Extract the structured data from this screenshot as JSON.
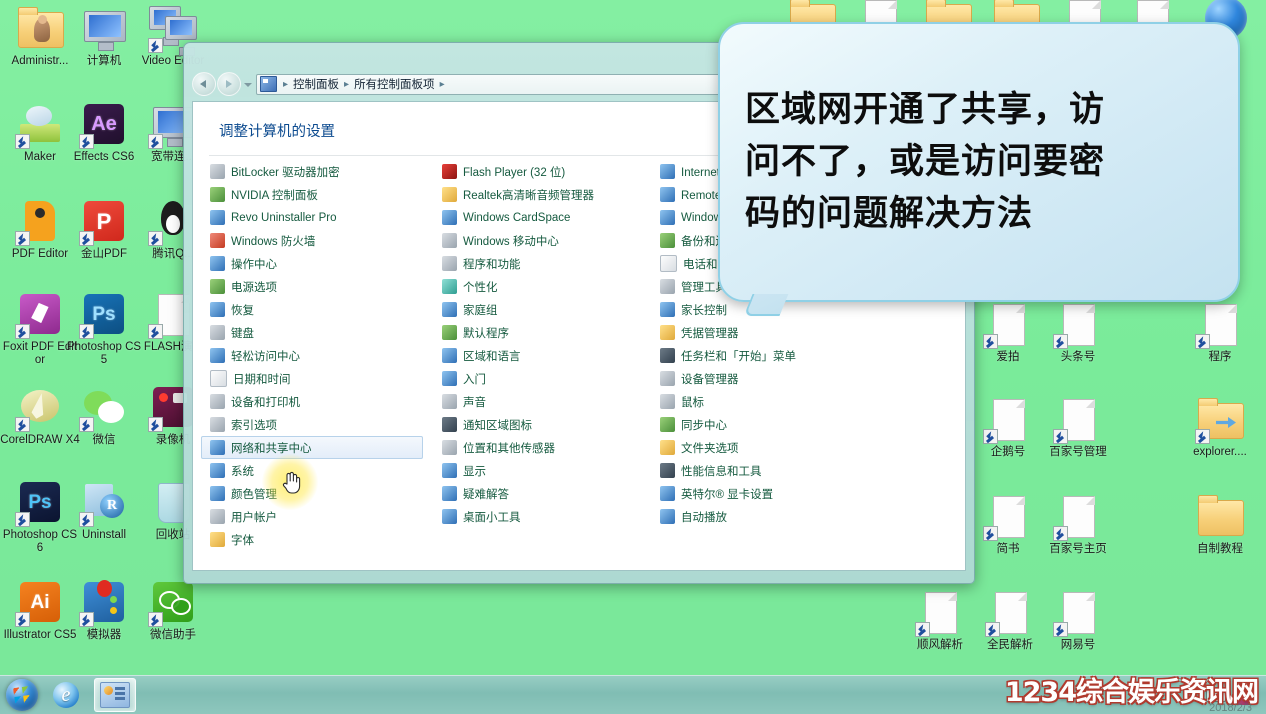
{
  "desktop": {
    "background_color": "#7ceb9c",
    "left_icons": [
      {
        "label": "Administr...",
        "art": "folder-user",
        "col": 0,
        "row": 0
      },
      {
        "label": "计算机",
        "art": "monitor",
        "col": 1,
        "row": 0
      },
      {
        "label": "Video Editor",
        "art": "monitor-dual",
        "col": 2,
        "row": 0
      },
      {
        "label": "Maker",
        "art": "cloud-box",
        "col": 0,
        "row": 1
      },
      {
        "label": "Effects CS6",
        "art": "ae",
        "col": 1,
        "row": 1
      },
      {
        "label": "宽带连...",
        "art": "monitor",
        "col": 2,
        "row": 1
      },
      {
        "label": "PDF Editor",
        "art": "pdf-orange",
        "col": 0,
        "row": 2
      },
      {
        "label": "金山PDF",
        "art": "pdf-red",
        "col": 1,
        "row": 2
      },
      {
        "label": "腾讯Q...",
        "art": "qq",
        "col": 2,
        "row": 2
      },
      {
        "label": "Foxit PDF Editor",
        "art": "foxit",
        "col": 0,
        "row": 3
      },
      {
        "label": "Photoshop CS5",
        "art": "ps-blue",
        "col": 1,
        "row": 3
      },
      {
        "label": "FLASH演...",
        "art": "doc",
        "col": 2,
        "row": 3
      },
      {
        "label": "CorelDRAW X4",
        "art": "corel",
        "col": 0,
        "row": 4
      },
      {
        "label": "微信",
        "art": "wechat",
        "col": 1,
        "row": 4
      },
      {
        "label": "录像机",
        "art": "recorder",
        "col": 2,
        "row": 4
      },
      {
        "label": "Photoshop CS6",
        "art": "ps-dark",
        "col": 0,
        "row": 5
      },
      {
        "label": "Uninstall",
        "art": "revo",
        "col": 1,
        "row": 5
      },
      {
        "label": "回收站",
        "art": "recycle",
        "col": 2,
        "row": 5
      },
      {
        "label": "Illustrator CS5",
        "art": "ai",
        "col": 0,
        "row": 6
      },
      {
        "label": "模拟器",
        "art": "emulator",
        "col": 1,
        "row": 6
      },
      {
        "label": "微信助手",
        "art": "wechat-helper",
        "col": 2,
        "row": 6
      }
    ],
    "top_right_icons": [
      {
        "label": "",
        "art": "folder"
      },
      {
        "label": "",
        "art": "doc"
      },
      {
        "label": "",
        "art": "folder"
      },
      {
        "label": "",
        "art": "folder"
      },
      {
        "label": "",
        "art": "doc"
      },
      {
        "label": "",
        "art": "doc"
      },
      {
        "label": "",
        "art": "globe"
      }
    ],
    "right_icons": [
      {
        "label": "爱拍",
        "art": "doc",
        "col": 0,
        "row": 0
      },
      {
        "label": "头条号",
        "art": "doc",
        "col": 1,
        "row": 0
      },
      {
        "label": "程序",
        "art": "doc",
        "col": 2,
        "row": 0
      },
      {
        "label": "企鹅号",
        "art": "doc",
        "col": 0,
        "row": 1
      },
      {
        "label": "百家号管理",
        "art": "doc",
        "col": 1,
        "row": 1
      },
      {
        "label": "explorer....",
        "art": "folder-explorer",
        "col": 2,
        "row": 1
      },
      {
        "label": "简书",
        "art": "doc",
        "col": 0,
        "row": 2
      },
      {
        "label": "百家号主页",
        "art": "doc",
        "col": 1,
        "row": 2
      },
      {
        "label": "自制教程",
        "art": "folder",
        "col": 2,
        "row": 2
      },
      {
        "label": "顺风解析",
        "art": "doc",
        "col": 0,
        "row": 3
      },
      {
        "label": "全民解析",
        "art": "doc",
        "col": 1,
        "row": 3
      },
      {
        "label": "网易号",
        "art": "doc",
        "col": 2,
        "row": 3
      }
    ]
  },
  "window": {
    "address": {
      "crumbs": [
        "控制面板",
        "所有控制面板项"
      ],
      "separator": "▸",
      "caret": "▾",
      "refresh_label": "↯"
    },
    "heading": "调整计算机的设置",
    "columns": [
      {
        "items": [
          {
            "label": "BitLocker 驱动器加密",
            "icon": "i-gray"
          },
          {
            "label": "NVIDIA 控制面板",
            "icon": "i-green"
          },
          {
            "label": "Revo Uninstaller Pro",
            "icon": "i-blue"
          },
          {
            "label": "Windows 防火墙",
            "icon": "i-red"
          },
          {
            "label": "操作中心",
            "icon": "i-blue"
          },
          {
            "label": "电源选项",
            "icon": "i-green"
          },
          {
            "label": "恢复",
            "icon": "i-blue"
          },
          {
            "label": "键盘",
            "icon": "i-gray"
          },
          {
            "label": "轻松访问中心",
            "icon": "i-blue"
          },
          {
            "label": "日期和时间",
            "icon": "i-white"
          },
          {
            "label": "设备和打印机",
            "icon": "i-gray"
          },
          {
            "label": "索引选项",
            "icon": "i-gray"
          },
          {
            "label": "网络和共享中心",
            "icon": "i-blue",
            "selected": true
          },
          {
            "label": "系统",
            "icon": "i-blue"
          },
          {
            "label": "颜色管理",
            "icon": "i-blue"
          },
          {
            "label": "用户帐户",
            "icon": "i-gray"
          },
          {
            "label": "字体",
            "icon": "i-yellow"
          }
        ]
      },
      {
        "items": [
          {
            "label": "Flash Player (32 位)",
            "icon": "i-flash"
          },
          {
            "label": "Realtek高清晰音频管理器",
            "icon": "i-yellow"
          },
          {
            "label": "Windows CardSpace",
            "icon": "i-blue"
          },
          {
            "label": "Windows 移动中心",
            "icon": "i-gray"
          },
          {
            "label": "程序和功能",
            "icon": "i-gray"
          },
          {
            "label": "个性化",
            "icon": "i-teal"
          },
          {
            "label": "家庭组",
            "icon": "i-blue"
          },
          {
            "label": "默认程序",
            "icon": "i-green"
          },
          {
            "label": "区域和语言",
            "icon": "i-blue"
          },
          {
            "label": "入门",
            "icon": "i-blue"
          },
          {
            "label": "声音",
            "icon": "i-gray"
          },
          {
            "label": "通知区域图标",
            "icon": "i-dark"
          },
          {
            "label": "位置和其他传感器",
            "icon": "i-gray"
          },
          {
            "label": "显示",
            "icon": "i-blue"
          },
          {
            "label": "疑难解答",
            "icon": "i-blue"
          },
          {
            "label": "桌面小工具",
            "icon": "i-blue"
          }
        ]
      },
      {
        "items": [
          {
            "label": "Internet 选项",
            "icon": "i-blue"
          },
          {
            "label": "Remote App 和桌面连接",
            "icon": "i-blue"
          },
          {
            "label": "Windows Update",
            "icon": "i-blue"
          },
          {
            "label": "备份和还原",
            "icon": "i-green"
          },
          {
            "label": "电话和调制解调器",
            "icon": "i-white"
          },
          {
            "label": "管理工具",
            "icon": "i-gray"
          },
          {
            "label": "家长控制",
            "icon": "i-blue"
          },
          {
            "label": "凭据管理器",
            "icon": "i-yellow"
          },
          {
            "label": "任务栏和「开始」菜单",
            "icon": "i-dark"
          },
          {
            "label": "设备管理器",
            "icon": "i-gray"
          },
          {
            "label": "鼠标",
            "icon": "i-gray"
          },
          {
            "label": "同步中心",
            "icon": "i-green"
          },
          {
            "label": "文件夹选项",
            "icon": "i-yellow"
          },
          {
            "label": "性能信息和工具",
            "icon": "i-dark"
          },
          {
            "label": "英特尔® 显卡设置",
            "icon": "i-blue"
          },
          {
            "label": "自动播放",
            "icon": "i-blue"
          }
        ]
      }
    ]
  },
  "bubble": {
    "lines": [
      "区域网开通了共享，访",
      "问不了，或是访问要密",
      "码的问题解决方法"
    ],
    "text": "区域网开通了共享，访问不了，或是访问要密码的问题解决方法",
    "fill_color": "#cfe8f4",
    "border_color": "#8fd0e6"
  },
  "taskbar": {
    "start_label": "",
    "items": [
      {
        "name": "internet-explorer",
        "label": ""
      },
      {
        "name": "control-panel",
        "label": "",
        "active": true
      }
    ],
    "tray": {
      "keyboard": "",
      "app": ""
    },
    "watermark": "1234综合娱乐资讯网",
    "datestamp": "2018/2/3"
  }
}
